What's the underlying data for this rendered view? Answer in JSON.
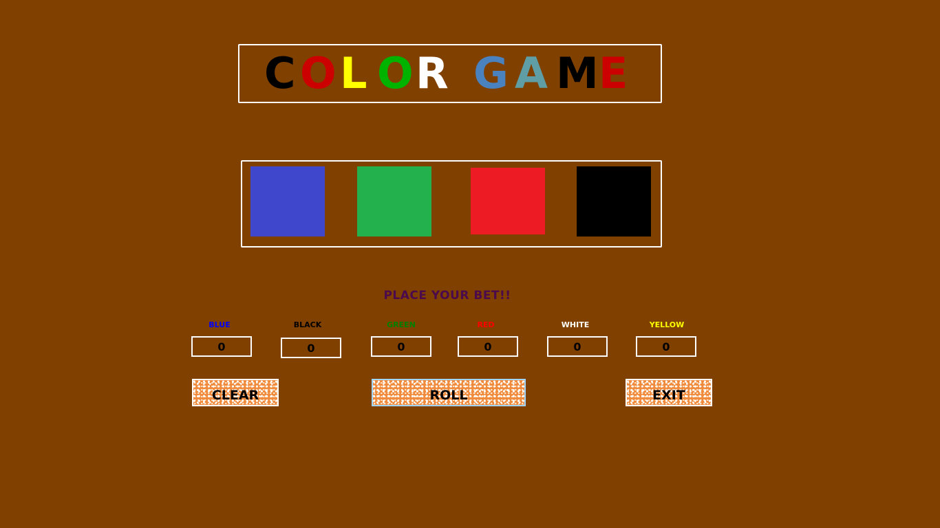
{
  "title": {
    "letters": [
      {
        "char": "C",
        "color": "#000000"
      },
      {
        "char": "O",
        "color": "#cc0000"
      },
      {
        "char": "L",
        "color": "#ffff00"
      },
      {
        "char": "O",
        "color": "#00b300"
      },
      {
        "char": "R",
        "color": "#ffffff"
      },
      {
        "char": "G",
        "color": "#4a82bf"
      },
      {
        "char": "A",
        "color": "#5e9ea4"
      },
      {
        "char": "M",
        "color": "#000000"
      },
      {
        "char": "E",
        "color": "#cc0000"
      }
    ]
  },
  "dice": [
    {
      "color_name": "blue",
      "color": "#3f48cc"
    },
    {
      "color_name": "green",
      "color": "#22b14c"
    },
    {
      "color_name": "red",
      "color": "#ed1c24"
    },
    {
      "color_name": "black",
      "color": "#000000"
    }
  ],
  "prompt": "PLACE YOUR BET!!",
  "bets": [
    {
      "label": "BLUE",
      "color": "#0000ff",
      "value": "0"
    },
    {
      "label": "BLACK",
      "color": "#000000",
      "value": "0"
    },
    {
      "label": "GREEN",
      "color": "#008000",
      "value": "0"
    },
    {
      "label": "RED",
      "color": "#ff0000",
      "value": "0"
    },
    {
      "label": "WHITE",
      "color": "#ffffff",
      "value": "0"
    },
    {
      "label": "YELLOW",
      "color": "#ffff00",
      "value": "0"
    }
  ],
  "buttons": {
    "clear": "CLEAR",
    "roll": "ROLL",
    "exit": "EXIT"
  },
  "colors": {
    "background": "#804000",
    "prompt": "#4b0a4b",
    "button_fill": "#f08a3c"
  }
}
